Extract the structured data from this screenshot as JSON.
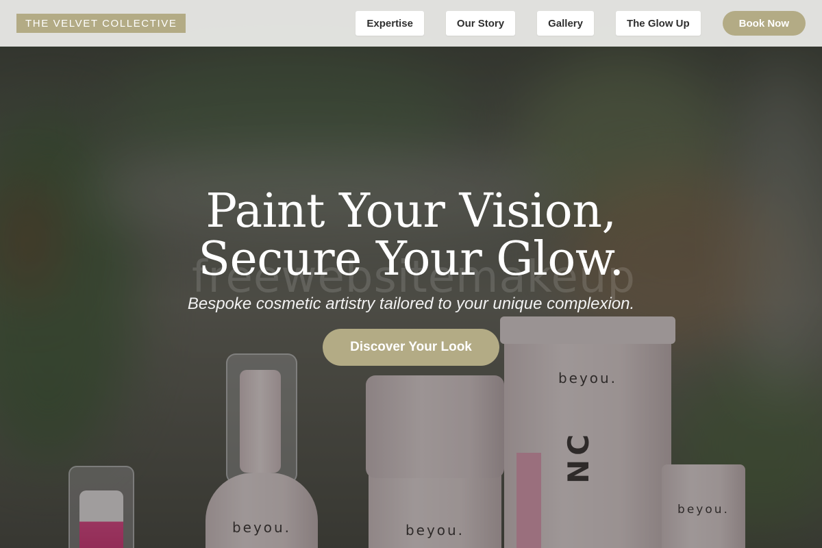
{
  "header": {
    "logo": "THE VELVET COLLECTIVE",
    "nav": [
      {
        "label": "Expertise"
      },
      {
        "label": "Our Story"
      },
      {
        "label": "Gallery"
      },
      {
        "label": "The Glow Up"
      }
    ],
    "cta": "Book Now"
  },
  "hero": {
    "headline_line1": "Paint Your Vision,",
    "headline_line2": "Secure Your Glow.",
    "subheadline": "Bespoke cosmetic artistry tailored to your unique complexion.",
    "cta": "Discover Your Look",
    "watermark": "freewebsitemakeup",
    "product_brand": "beyou.",
    "tube_text": "NC",
    "colors": {
      "accent": "#b3ab85",
      "header_bg": "#eeeeeb",
      "text_light": "#ffffff"
    }
  }
}
